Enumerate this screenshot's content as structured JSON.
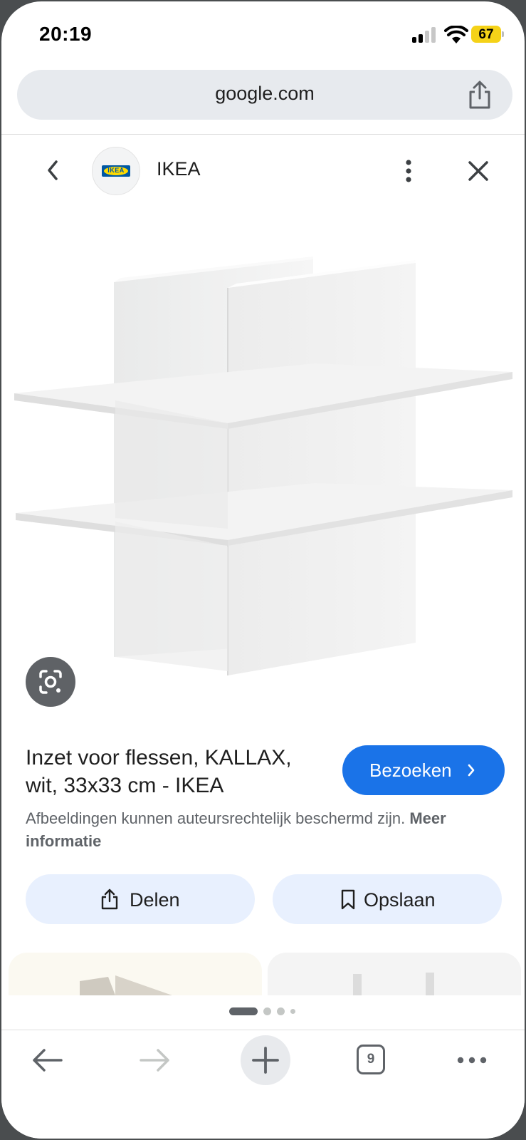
{
  "status_bar": {
    "time": "20:19",
    "battery": "67"
  },
  "url_bar": {
    "domain": "google.com"
  },
  "sheet_header": {
    "site_name": "IKEA",
    "logo_text": "IKEA"
  },
  "result": {
    "title": "Inzet voor flessen, KALLAX, wit, 33x33 cm - IKEA",
    "visit_label": "Bezoeken",
    "copyright_text": "Afbeeldingen kunnen auteursrechtelijk beschermd zijn.",
    "more_info_label": "Meer informatie"
  },
  "actions": {
    "share_label": "Delen",
    "save_label": "Opslaan"
  },
  "pager": {
    "pages": 4,
    "active": 0
  },
  "toolbar": {
    "tab_count": "9"
  },
  "colors": {
    "accent": "#1a73e8",
    "pill_bg": "#e8f0fe",
    "battery": "#f5d218"
  },
  "icons": [
    "back-chevron-icon",
    "more-vert-icon",
    "close-icon",
    "share-icon",
    "google-lens-icon",
    "bookmark-icon",
    "back-arrow-icon",
    "forward-arrow-icon",
    "plus-icon",
    "tabs-icon",
    "more-horiz-icon"
  ]
}
